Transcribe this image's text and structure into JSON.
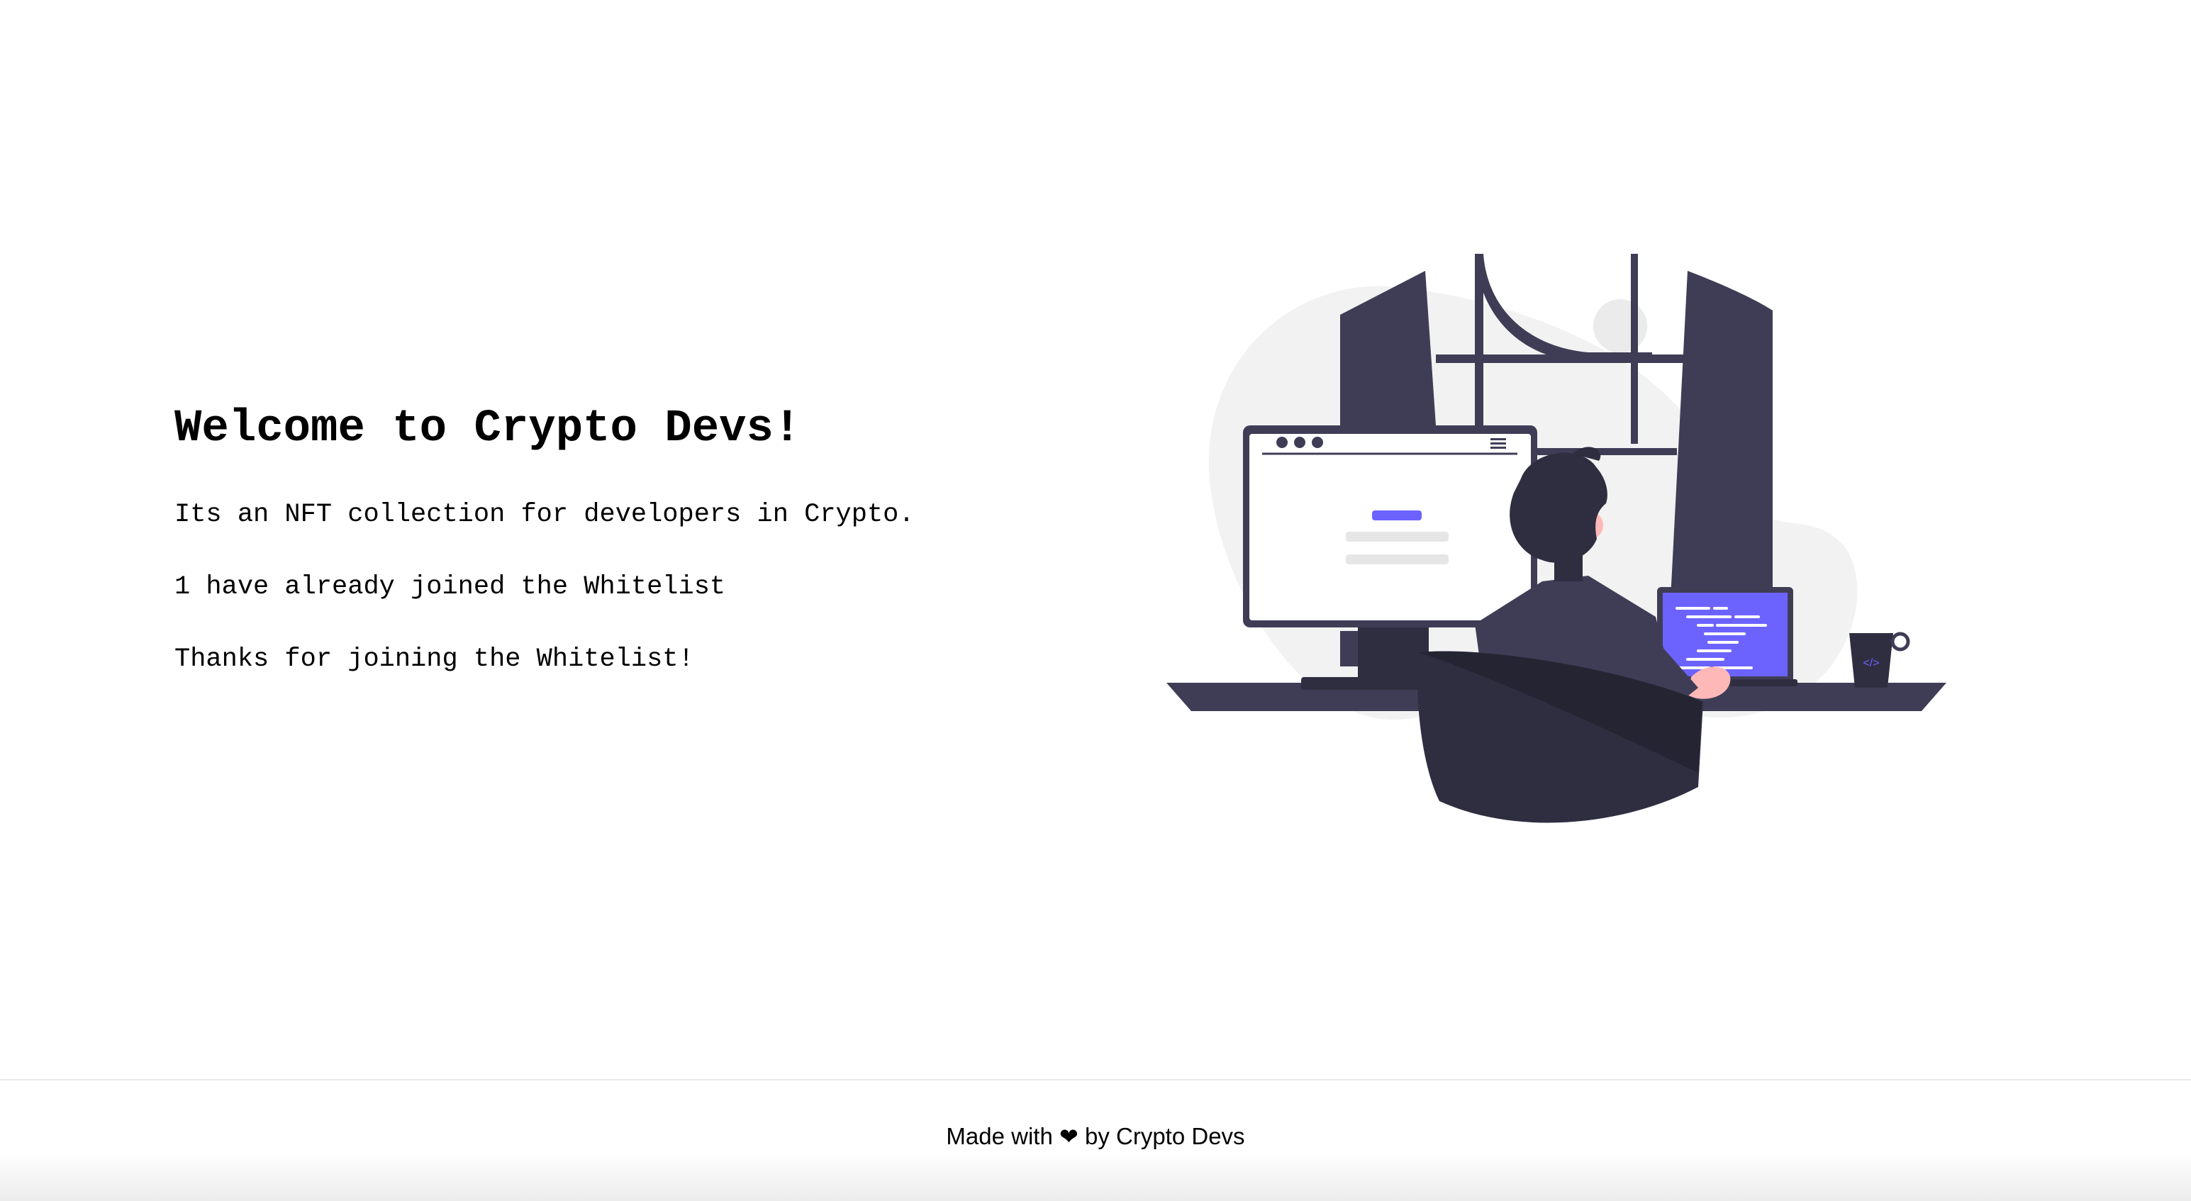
{
  "hero": {
    "title": "Welcome to Crypto Devs!",
    "description": "Its an NFT collection for developers in Crypto.",
    "joined_count": "1 have already joined the Whitelist",
    "status_message": "Thanks for joining the Whitelist!"
  },
  "illustration": {
    "icon": "developer-at-desk-illustration",
    "accent_color": "#6c63ff",
    "dark_color": "#3f3d56",
    "hair_color": "#2f2e41",
    "skin_color": "#ffb8b8",
    "blob_color": "#f2f2f2"
  },
  "footer": {
    "prefix": "Made with",
    "heart_glyph": "❤",
    "suffix": "by Crypto Devs"
  }
}
